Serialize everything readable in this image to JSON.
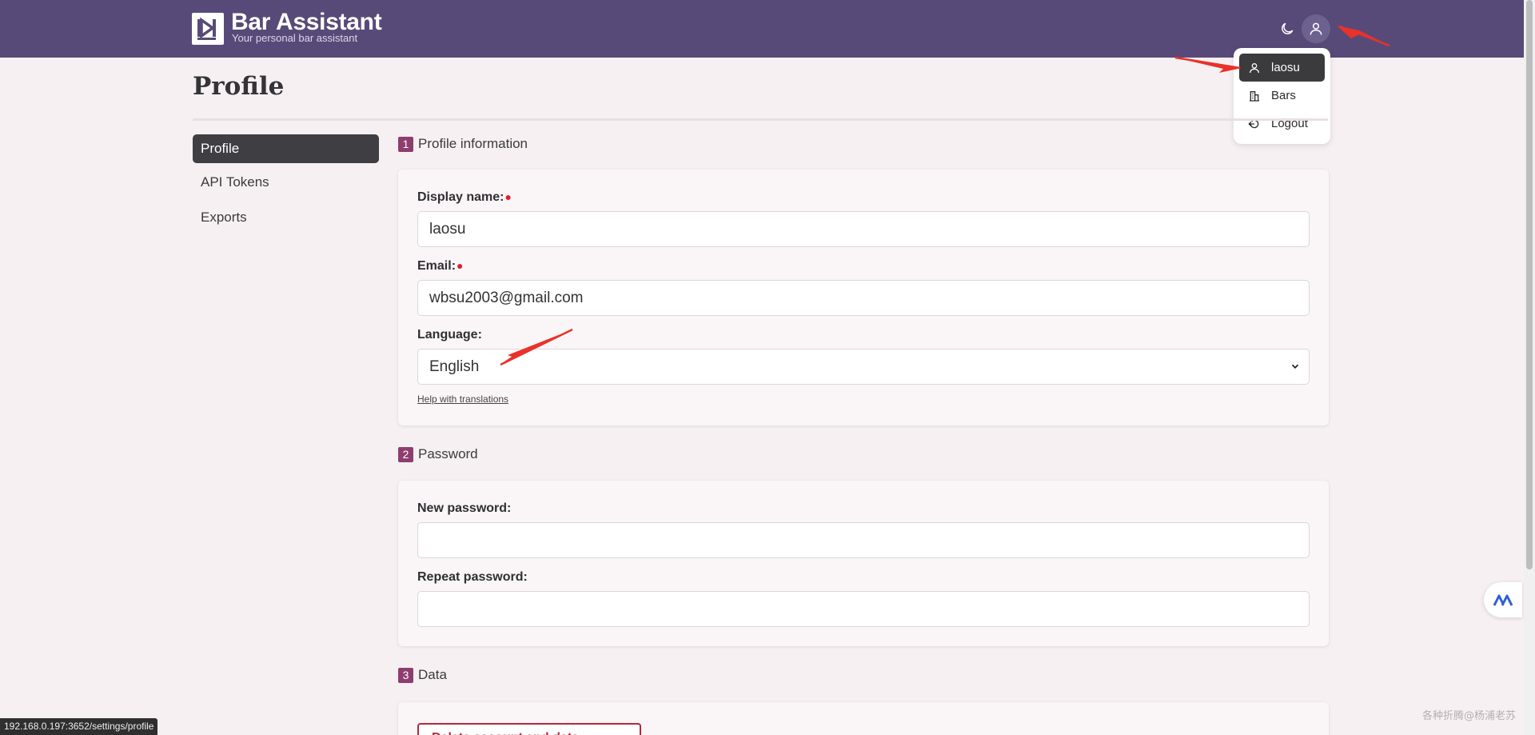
{
  "header": {
    "brand_name": "Bar Assistant",
    "brand_tagline": "Your personal bar assistant"
  },
  "user_menu": {
    "items": [
      {
        "label": "laosu",
        "icon": "user-icon",
        "active": true
      },
      {
        "label": "Bars",
        "icon": "building-icon",
        "active": false
      },
      {
        "label": "Logout",
        "icon": "logout-icon",
        "active": false
      }
    ]
  },
  "page": {
    "title": "Profile"
  },
  "sidenav": {
    "items": [
      {
        "label": "Profile",
        "active": true
      },
      {
        "label": "API Tokens",
        "active": false
      },
      {
        "label": "Exports",
        "active": false
      }
    ]
  },
  "sections": {
    "profile": {
      "number": "1",
      "title": "Profile information",
      "display_name_label": "Display name:",
      "display_name_value": "laosu",
      "email_label": "Email:",
      "email_value": "wbsu2003@gmail.com",
      "language_label": "Language:",
      "language_value": "English",
      "help_link": "Help with translations"
    },
    "password": {
      "number": "2",
      "title": "Password",
      "new_label": "New password:",
      "new_value": "",
      "repeat_label": "Repeat password:",
      "repeat_value": ""
    },
    "data": {
      "number": "3",
      "title": "Data",
      "delete_button": "Delete account and data"
    }
  },
  "status_bar": {
    "url": "192.168.0.197:3652/settings/profile"
  },
  "watermark": "各种折腾@杨浦老苏",
  "colors": {
    "header_bg": "#584a78",
    "accent": "#8d3e6f",
    "danger": "#b5283b",
    "page_bg": "#f7f0f2"
  }
}
